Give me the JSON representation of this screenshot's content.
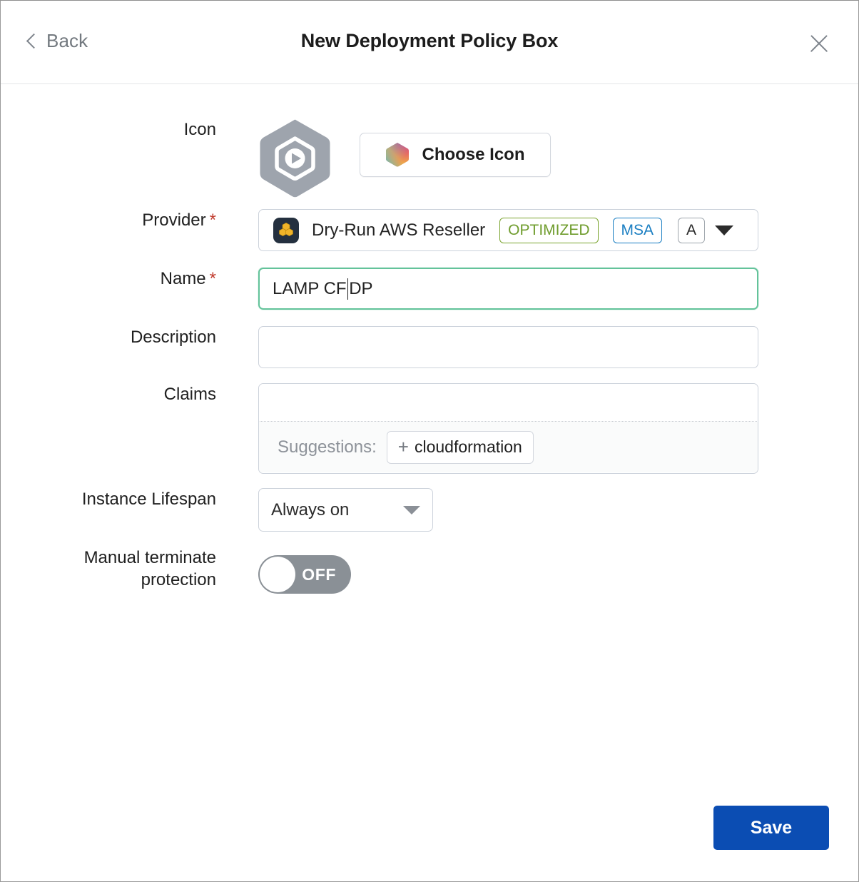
{
  "header": {
    "back_label": "Back",
    "title": "New Deployment Policy Box",
    "back_icon": "chevron-left-icon",
    "close_icon": "close-icon"
  },
  "form": {
    "icon": {
      "label": "Icon",
      "preview_icon": "hexagon-play-icon",
      "choose_button_label": "Choose Icon",
      "choose_button_icon": "color-wheel-hexagon-icon"
    },
    "provider": {
      "label": "Provider",
      "required_marker": "*",
      "logo_icon": "cubes-logo-icon",
      "value": "Dry-Run AWS Reseller",
      "badges": [
        {
          "text": "OPTIMIZED",
          "color": "#7aa42f"
        },
        {
          "text": "MSA",
          "color": "#1a7ec2"
        },
        {
          "text": "A",
          "color": "#9fa6ad"
        }
      ],
      "caret_icon": "chevron-down-icon"
    },
    "name": {
      "label": "Name",
      "required_marker": "*",
      "value_before_caret": "LAMP CF",
      "value_after_caret": "DP",
      "focused": true,
      "focus_color": "#63c39a"
    },
    "description": {
      "label": "Description",
      "value": "",
      "placeholder": ""
    },
    "claims": {
      "label": "Claims",
      "value": "",
      "placeholder": "",
      "suggestions_label": "Suggestions:",
      "suggestions": [
        {
          "plus": "+",
          "text": "cloudformation"
        }
      ]
    },
    "instance_lifespan": {
      "label": "Instance Lifespan",
      "value": "Always on",
      "caret_icon": "chevron-down-icon"
    },
    "manual_terminate_protection": {
      "label_line1": "Manual terminate",
      "label_line2": "protection",
      "state_text": "OFF",
      "checked": false
    }
  },
  "footer": {
    "save_label": "Save",
    "save_color": "#0b4db3"
  }
}
